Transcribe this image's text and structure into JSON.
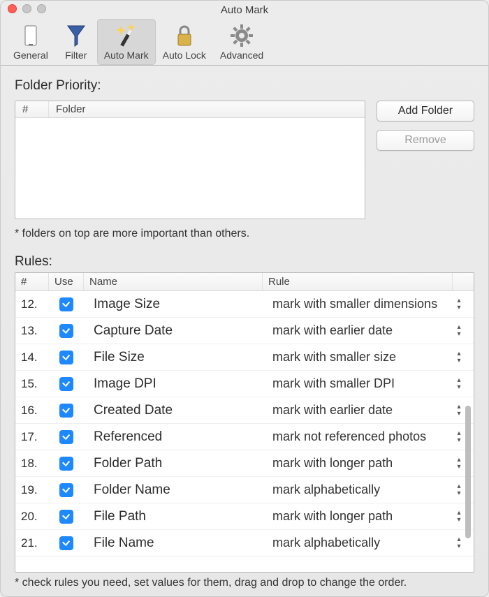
{
  "window": {
    "title": "Auto Mark"
  },
  "toolbar": {
    "items": [
      {
        "label": "General"
      },
      {
        "label": "Filter"
      },
      {
        "label": "Auto Mark"
      },
      {
        "label": "Auto Lock"
      },
      {
        "label": "Advanced"
      }
    ],
    "selected_index": 2
  },
  "folder_priority": {
    "section_label": "Folder Priority:",
    "columns": {
      "num": "#",
      "folder": "Folder"
    },
    "hint": "* folders on top are more important than others.",
    "add_button": "Add Folder",
    "remove_button": "Remove",
    "remove_enabled": false
  },
  "rules": {
    "section_label": "Rules:",
    "columns": {
      "num": "#",
      "use": "Use",
      "name": "Name",
      "rule": "Rule"
    },
    "hint": "* check rules you need, set values for them, drag and drop to change the order.",
    "rows": [
      {
        "num": "12.",
        "use": true,
        "name": "Image Size",
        "rule": "mark with smaller dimensions"
      },
      {
        "num": "13.",
        "use": true,
        "name": "Capture Date",
        "rule": "mark with earlier date"
      },
      {
        "num": "14.",
        "use": true,
        "name": "File Size",
        "rule": "mark with smaller size"
      },
      {
        "num": "15.",
        "use": true,
        "name": "Image DPI",
        "rule": "mark with smaller DPI"
      },
      {
        "num": "16.",
        "use": true,
        "name": "Created Date",
        "rule": "mark with earlier date"
      },
      {
        "num": "17.",
        "use": true,
        "name": "Referenced",
        "rule": "mark not referenced photos"
      },
      {
        "num": "18.",
        "use": true,
        "name": "Folder Path",
        "rule": "mark with longer path"
      },
      {
        "num": "19.",
        "use": true,
        "name": "Folder Name",
        "rule": "mark alphabetically"
      },
      {
        "num": "20.",
        "use": true,
        "name": "File Path",
        "rule": "mark with longer path"
      },
      {
        "num": "21.",
        "use": true,
        "name": "File Name",
        "rule": "mark alphabetically"
      }
    ]
  }
}
